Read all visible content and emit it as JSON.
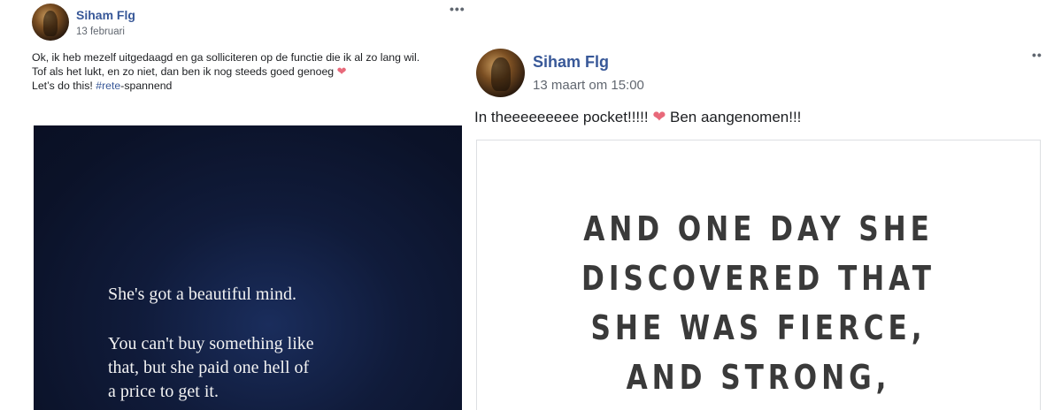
{
  "posts": [
    {
      "author": "Siham Flg",
      "timestamp": "13 februari",
      "more_label": "•••",
      "text": {
        "line1": "Ok, ik heb mezelf uitgedaagd en ga solliciteren op de functie die ik al zo lang wil.",
        "line2": "Tof als het lukt, en zo niet, dan ben ik nog steeds goed genoeg",
        "line3_prefix": "Let’s do this! ",
        "hashtag": "#rete",
        "line3_suffix": "-spannend"
      },
      "image_quote": [
        "She's got a beautiful mind.",
        "You can't buy something like",
        "that, but she paid one hell of",
        "a price to get it."
      ]
    },
    {
      "author": "Siham Flg",
      "timestamp": "13 maart om 15:00",
      "more_label": "••",
      "text": {
        "before_heart": "In theeeeeeeee pocket!!!!! ",
        "after_heart": " Ben aangenomen!!!"
      },
      "image_quote": [
        "AND ONE DAY SHE",
        "DISCOVERED THAT",
        "SHE WAS FIERCE,",
        "AND STRONG,"
      ]
    }
  ],
  "icons": {
    "heart": "❤",
    "avatar": "avatar-photo"
  },
  "colors": {
    "author_link": "#385898",
    "heart": "#e8697a",
    "left_image_bg": "#0b1228"
  }
}
